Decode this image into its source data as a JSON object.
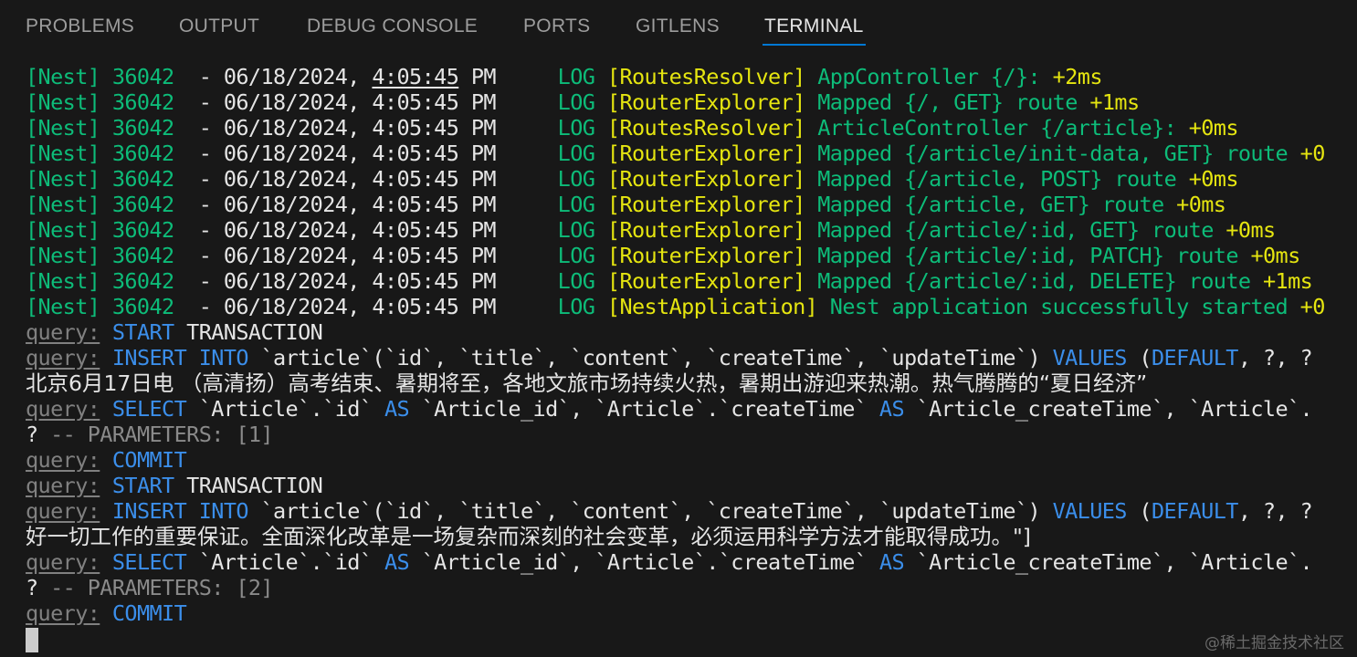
{
  "panel": {
    "tabs": [
      "PROBLEMS",
      "OUTPUT",
      "DEBUG CONSOLE",
      "PORTS",
      "GITLENS",
      "TERMINAL"
    ],
    "active_tab": "TERMINAL"
  },
  "terminal": {
    "nest_prefix": "[Nest] 36042",
    "date": "06/18/2024,",
    "time": "4:05:45",
    "ampm": "PM",
    "level": "LOG",
    "logs": [
      {
        "context": "[RoutesResolver]",
        "message": "AppController {/}:",
        "delta": "+2ms"
      },
      {
        "context": "[RouterExplorer]",
        "message": "Mapped {/, GET} route",
        "delta": "+1ms"
      },
      {
        "context": "[RoutesResolver]",
        "message": "ArticleController {/article}:",
        "delta": "+0ms"
      },
      {
        "context": "[RouterExplorer]",
        "message": "Mapped {/article/init-data, GET} route",
        "delta": "+0"
      },
      {
        "context": "[RouterExplorer]",
        "message": "Mapped {/article, POST} route",
        "delta": "+0ms"
      },
      {
        "context": "[RouterExplorer]",
        "message": "Mapped {/article, GET} route",
        "delta": "+0ms"
      },
      {
        "context": "[RouterExplorer]",
        "message": "Mapped {/article/:id, GET} route",
        "delta": "+0ms"
      },
      {
        "context": "[RouterExplorer]",
        "message": "Mapped {/article/:id, PATCH} route",
        "delta": "+0ms"
      },
      {
        "context": "[RouterExplorer]",
        "message": "Mapped {/article/:id, DELETE} route",
        "delta": "+1ms"
      },
      {
        "context": "[NestApplication]",
        "message": "Nest application successfully started",
        "delta": "+0"
      }
    ],
    "query_label": "query:",
    "start_transaction": [
      "START",
      " TRANSACTION"
    ],
    "insert_1": "INSERT",
    "insert_2": "INTO",
    "insert_cols": " `article`(`id`, `title`, `content`, `createTime`, `updateTime`) ",
    "insert_values": "VALUES",
    "insert_paren": " (",
    "insert_default": "DEFAULT",
    "insert_tail": ", ?, ?",
    "cjk_line_1": "北京6月17日电 （高清扬）高考结束、暑期将至，各地文旅市场持续火热，暑期出游迎来热潮。热气腾腾的“夏日经济”",
    "select_kw": "SELECT",
    "select_part1": " `Article`.`id` ",
    "as_kw": "AS",
    "select_part2": " `Article_id`, `Article`.`createTime` ",
    "select_part3": " `Article_createTime`, `Article`.",
    "params_1": "? -- PARAMETERS: [1]",
    "params_2": "? -- PARAMETERS: [2]",
    "commit": "COMMIT",
    "cjk_line_2": "好一切工作的重要保证。全面深化改革是一场复杂而深刻的社会变革，必须运用科学方法才能取得成功。\"]"
  },
  "watermark": "@稀土掘金技术社区"
}
